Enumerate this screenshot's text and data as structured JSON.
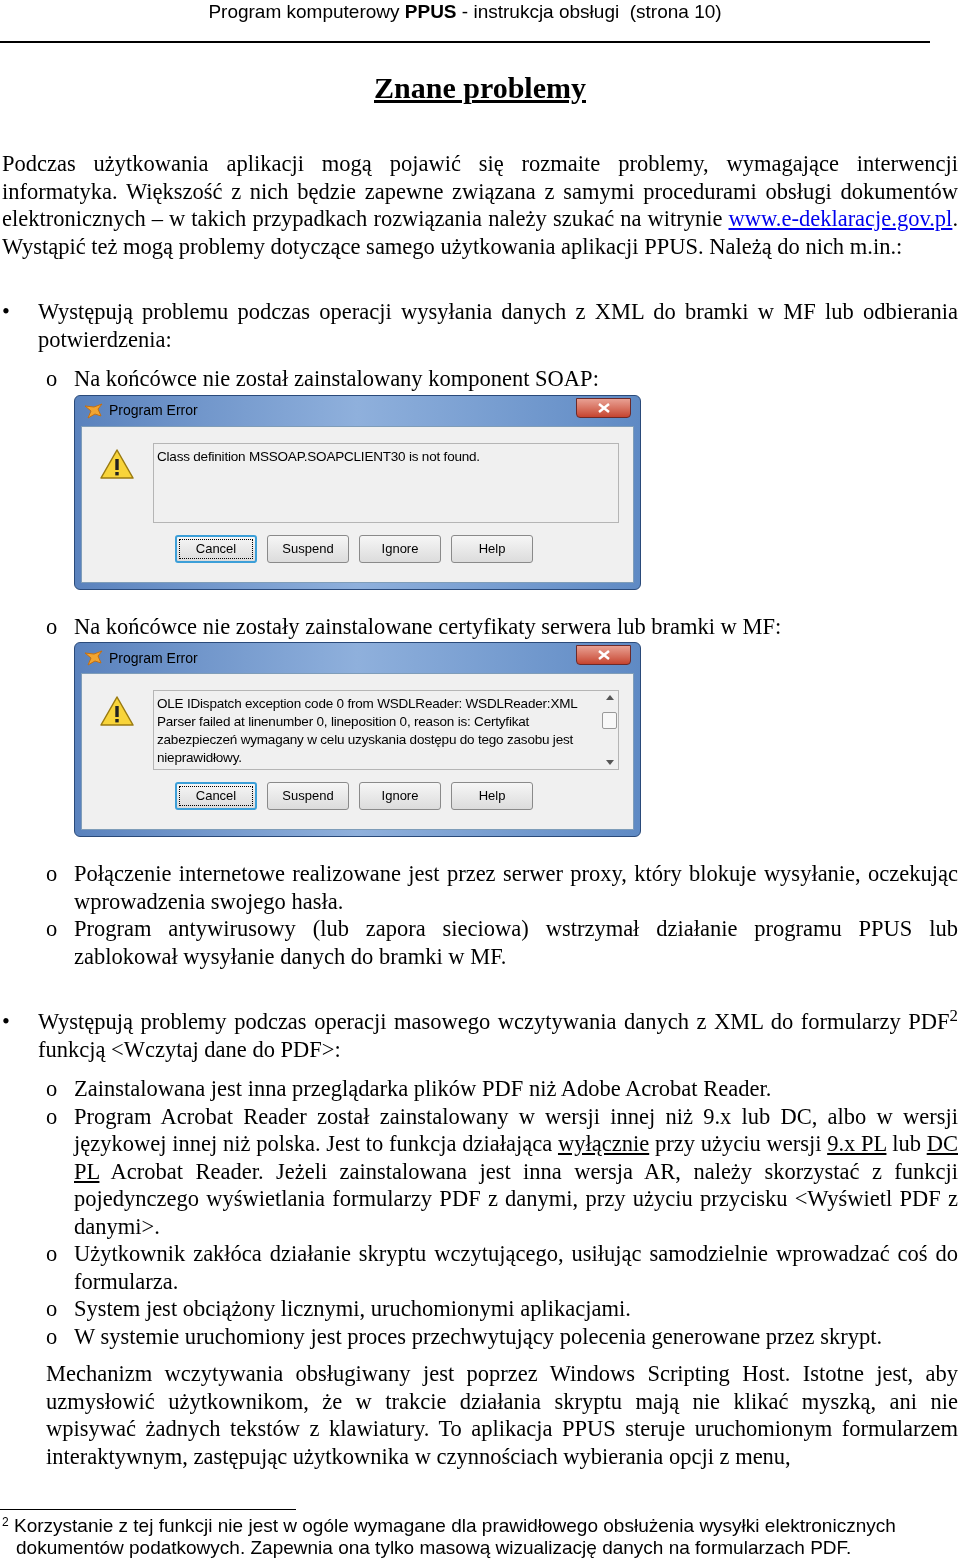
{
  "header": "Program komputerowy **PPUS** - instrukcja obsługi  (strona 10)",
  "title": "Znane problemy",
  "intro": [
    {
      "kind": "text",
      "text": "Podczas użytkowania aplikacji mogą pojawić się rozmaite problemy, wymagające interwencji informatyka. Większość z nich będzie zapewne związana z samymi procedurami obsługi dokumentów elektronicznych – w takich przypadkach rozwiązania należy szukać na witrynie "
    },
    {
      "kind": "link",
      "text": "www.e-deklaracje.gov.pl"
    },
    {
      "kind": "text",
      "text": ". Wystąpić też mogą problemy dotyczące samego użytkowania aplikacji PPUS. Należą do nich m.in.:"
    }
  ],
  "sections": [
    {
      "marker": "•",
      "text": [
        {
          "kind": "text",
          "text": "Występują problemu podczas operacji wysyłania danych z XML do bramki w MF lub odbierania potwierdzenia:"
        }
      ],
      "items": [
        {
          "marker": "o",
          "text": [
            {
              "kind": "text",
              "text": "Na końcówce nie został zainstalowany komponent SOAP:"
            }
          ],
          "dialog": {
            "title": "Program Error",
            "message": "Class definition MSSOAP.SOAPCLIENT30 is not found.",
            "scrollbar": false,
            "buttons": [
              {
                "label": "Cancel",
                "focused": true
              },
              {
                "label": "Suspend",
                "focused": false
              },
              {
                "label": "Ignore",
                "focused": false
              },
              {
                "label": "Help",
                "focused": false
              }
            ]
          }
        },
        {
          "marker": "o",
          "text": [
            {
              "kind": "text",
              "text": "Na końcówce nie zostały zainstalowane certyfikaty serwera lub bramki w MF:"
            }
          ],
          "dialog": {
            "title": "Program Error",
            "message": "OLE IDispatch exception code 0 from WSDLReader: WSDLReader:XML Parser failed at linenumber 0, lineposition 0, reason is: Certyfikat zabezpieczeń wymagany w celu uzyskania dostępu do tego zasobu jest nieprawidłowy.",
            "scrollbar": true,
            "buttons": [
              {
                "label": "Cancel",
                "focused": true
              },
              {
                "label": "Suspend",
                "focused": false
              },
              {
                "label": "Ignore",
                "focused": false
              },
              {
                "label": "Help",
                "focused": false
              }
            ]
          }
        },
        {
          "marker": "o",
          "text": [
            {
              "kind": "text",
              "text": "Połączenie internetowe realizowane jest przez serwer proxy, który blokuje wysyłanie, oczekując wprowadzenia swojego hasła."
            }
          ]
        },
        {
          "marker": "o",
          "text": [
            {
              "kind": "text",
              "text": "Program antywirusowy (lub zapora sieciowa) wstrzymał działanie programu PPUS lub zablokował wysyłanie danych do bramki w MF."
            }
          ]
        }
      ]
    },
    {
      "marker": "•",
      "text": [
        {
          "kind": "text",
          "text": "Występują problemy podczas operacji masowego wczytywania danych z XML do formularzy PDF$^{2}$ funkcją <Wczytaj dane do PDF>:"
        }
      ],
      "items": [
        {
          "marker": "o",
          "text": [
            {
              "kind": "text",
              "text": "Zainstalowana jest inna przeglądarka plików PDF niż Adobe Acrobat Reader."
            }
          ]
        },
        {
          "marker": "o",
          "text": [
            {
              "kind": "text",
              "text": "Program Acrobat Reader został zainstalowany w wersji innej niż 9.x lub DC, albo w wersji językowej innej niż polska. Jest to funkcja działająca "
            },
            {
              "kind": "underline",
              "text": "wyłącznie"
            },
            {
              "kind": "text",
              "text": " przy użyciu wersji "
            },
            {
              "kind": "underline",
              "text": "9.x PL"
            },
            {
              "kind": "text",
              "text": " lub "
            },
            {
              "kind": "underline",
              "text": "DC PL"
            },
            {
              "kind": "text",
              "text": " Acrobat Reader. Jeżeli zainstalowana jest inna wersja AR, należy skorzystać z funkcji pojedynczego wyświetlania formularzy PDF z danymi, przy użyciu przycisku <Wyświetl PDF z danymi>."
            }
          ]
        },
        {
          "marker": "o",
          "text": [
            {
              "kind": "text",
              "text": "Użytkownik zakłóca działanie skryptu wczytującego, usiłując samodzielnie wprowadzać coś do formularza."
            }
          ]
        },
        {
          "marker": "o",
          "text": [
            {
              "kind": "text",
              "text": "System jest obciążony licznymi, uruchomionymi aplikacjami."
            }
          ]
        },
        {
          "marker": "o",
          "text": [
            {
              "kind": "text",
              "text": "W systemie uruchomiony jest proces przechwytujący polecenia generowane przez skrypt."
            }
          ]
        }
      ]
    }
  ],
  "closing": "Mechanizm wczytywania obsługiwany jest poprzez Windows Scripting Host. Istotne jest, aby uzmysłowić użytkownikom, że w trakcie działania skryptu mają nie klikać myszką, ani nie wpisywać żadnych tekstów z klawiatury. To aplikacja PPUS steruje uruchomionym formularzem interaktywnym, zastępując użytkownika w czynnościach wybierania opcji z menu,",
  "footnote": {
    "mark": "2",
    "text": "Korzystanie z tej funkcji nie jest w ogóle wymagane dla prawidłowego obsłużenia wysyłki elektronicznych dokumentów podatkowych. Zapewnia ona tylko masową wizualizację danych na formularzach PDF."
  }
}
